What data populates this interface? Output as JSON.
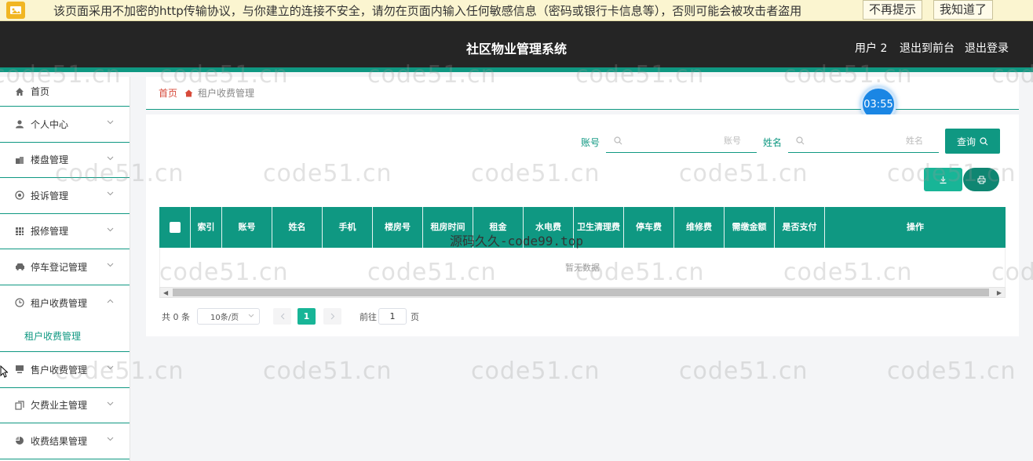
{
  "security_bar": {
    "message": "该页面采用不加密的http传输协议，与你建立的连接不安全，请勿在页面内输入任何敏感信息（密码或银行卡信息等），否则可能会被攻击者盗用",
    "dismiss_forever": "不再提示",
    "acknowledge": "我知道了"
  },
  "header": {
    "title": "社区物业管理系统",
    "user": "用户 2",
    "back_to_front": "退出到前台",
    "logout": "退出登录"
  },
  "sidebar": {
    "items": [
      {
        "label": "首页",
        "icon": "home-icon"
      },
      {
        "label": "个人中心",
        "icon": "user-icon"
      },
      {
        "label": "楼盘管理",
        "icon": "building-icon"
      },
      {
        "label": "投诉管理",
        "icon": "complaint-icon"
      },
      {
        "label": "报修管理",
        "icon": "grid-icon"
      },
      {
        "label": "停车登记管理",
        "icon": "car-icon"
      },
      {
        "label": "租户收费管理",
        "icon": "clock-icon"
      },
      {
        "label": "售户收费管理",
        "icon": "monitor-icon"
      },
      {
        "label": "欠费业主管理",
        "icon": "copy-icon"
      },
      {
        "label": "收费结果管理",
        "icon": "pie-icon"
      }
    ],
    "submenu": {
      "label": "租户收费管理"
    }
  },
  "breadcrumb": {
    "home": "首页",
    "current": "租户收费管理"
  },
  "timer": "03:55",
  "search": {
    "account_label": "账号",
    "account_placeholder": "账号",
    "name_label": "姓名",
    "name_placeholder": "姓名",
    "query_button": "查询"
  },
  "table": {
    "columns": [
      "索引",
      "账号",
      "姓名",
      "手机",
      "楼房号",
      "租房时间",
      "租金",
      "水电费",
      "卫生清理费",
      "停车费",
      "维修费",
      "需缴金额",
      "是否支付",
      "操作"
    ],
    "empty_text": "暂无数据"
  },
  "pagination": {
    "total": "共 0 条",
    "page_size": "10条/页",
    "current_page": "1",
    "goto_prefix": "前往",
    "goto_value": "1",
    "goto_suffix": "页"
  },
  "watermark": "code51.cn",
  "center_watermark": "源码久久-code99.top",
  "colors": {
    "accent": "#0f9882",
    "header_bg": "#252525",
    "security_bar_bg": "#fbf5d0"
  }
}
